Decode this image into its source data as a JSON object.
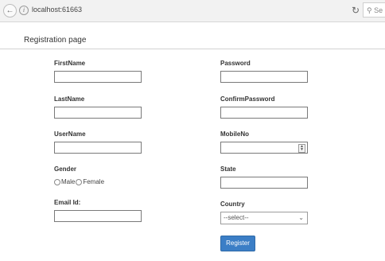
{
  "browser": {
    "url": "localhost:61663",
    "search_placeholder": "Se"
  },
  "page": {
    "title": "Registration page"
  },
  "form": {
    "first_name_label": "FirstName",
    "last_name_label": "LastName",
    "user_name_label": "UserName",
    "gender_label": "Gender",
    "gender_options": [
      "Male",
      "Female"
    ],
    "email_label": "Email Id:",
    "password_label": "Password",
    "confirm_password_label": "ConfirmPassword",
    "mobile_label": "MobileNo",
    "state_label": "State",
    "country_label": "Country",
    "country_selected": "--select--",
    "register_label": "Register"
  }
}
